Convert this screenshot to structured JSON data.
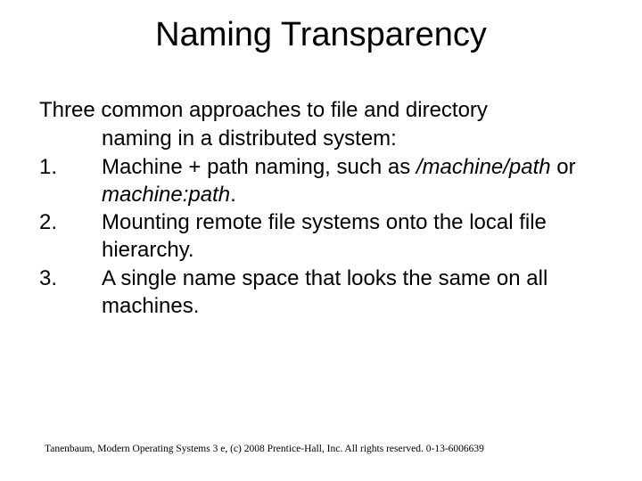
{
  "title": "Naming Transparency",
  "intro": {
    "line1": "Three common approaches to file and directory",
    "line2": "naming in a distributed system:"
  },
  "items": [
    {
      "num": "1.",
      "text_pre": "Machine + path naming, such as ",
      "italic": "/machine/path",
      "mid": " or ",
      "italic2": "machine:path",
      "post": "."
    },
    {
      "num": "2.",
      "text": "Mounting remote file systems onto the local file hierarchy."
    },
    {
      "num": "3.",
      "text": "A single name space that looks the same on all machines."
    }
  ],
  "footer": "Tanenbaum, Modern Operating Systems 3 e, (c) 2008 Prentice-Hall, Inc. All rights reserved. 0-13-6006639"
}
